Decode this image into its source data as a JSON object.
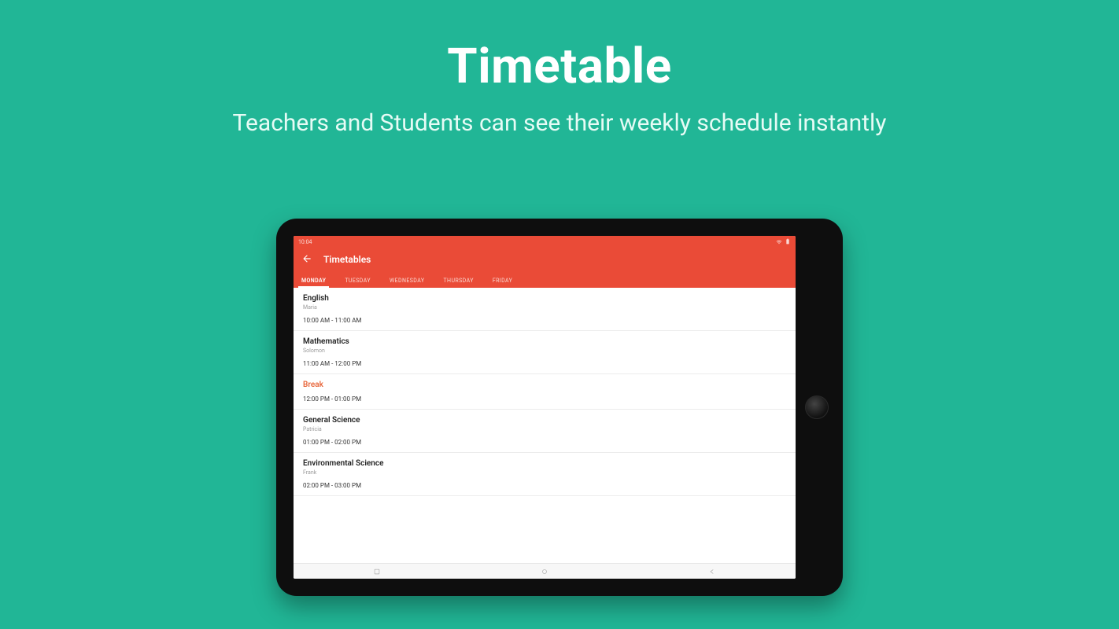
{
  "hero": {
    "title": "Timetable",
    "subtitle": "Teachers and Students can see their weekly schedule instantly"
  },
  "status": {
    "time": "10:04"
  },
  "appbar": {
    "title": "Timetables"
  },
  "tabs": [
    {
      "label": "MONDAY",
      "active": true
    },
    {
      "label": "TUESDAY",
      "active": false
    },
    {
      "label": "WEDNESDAY",
      "active": false
    },
    {
      "label": "THURSDAY",
      "active": false
    },
    {
      "label": "FRIDAY",
      "active": false
    }
  ],
  "items": [
    {
      "title": "English",
      "sub": "Maria",
      "time": "10:00 AM - 11:00 AM",
      "break": false
    },
    {
      "title": "Mathematics",
      "sub": "Solomon",
      "time": "11:00 AM - 12:00 PM",
      "break": false
    },
    {
      "title": "Break",
      "sub": "",
      "time": "12:00 PM - 01:00 PM",
      "break": true
    },
    {
      "title": "General Science",
      "sub": "Patricia",
      "time": "01:00 PM - 02:00 PM",
      "break": false
    },
    {
      "title": "Environmental Science",
      "sub": "Frank",
      "time": "02:00 PM - 03:00 PM",
      "break": false
    }
  ],
  "colors": {
    "bg": "#21b696",
    "accent": "#ea4b37",
    "break": "#e8683d"
  }
}
